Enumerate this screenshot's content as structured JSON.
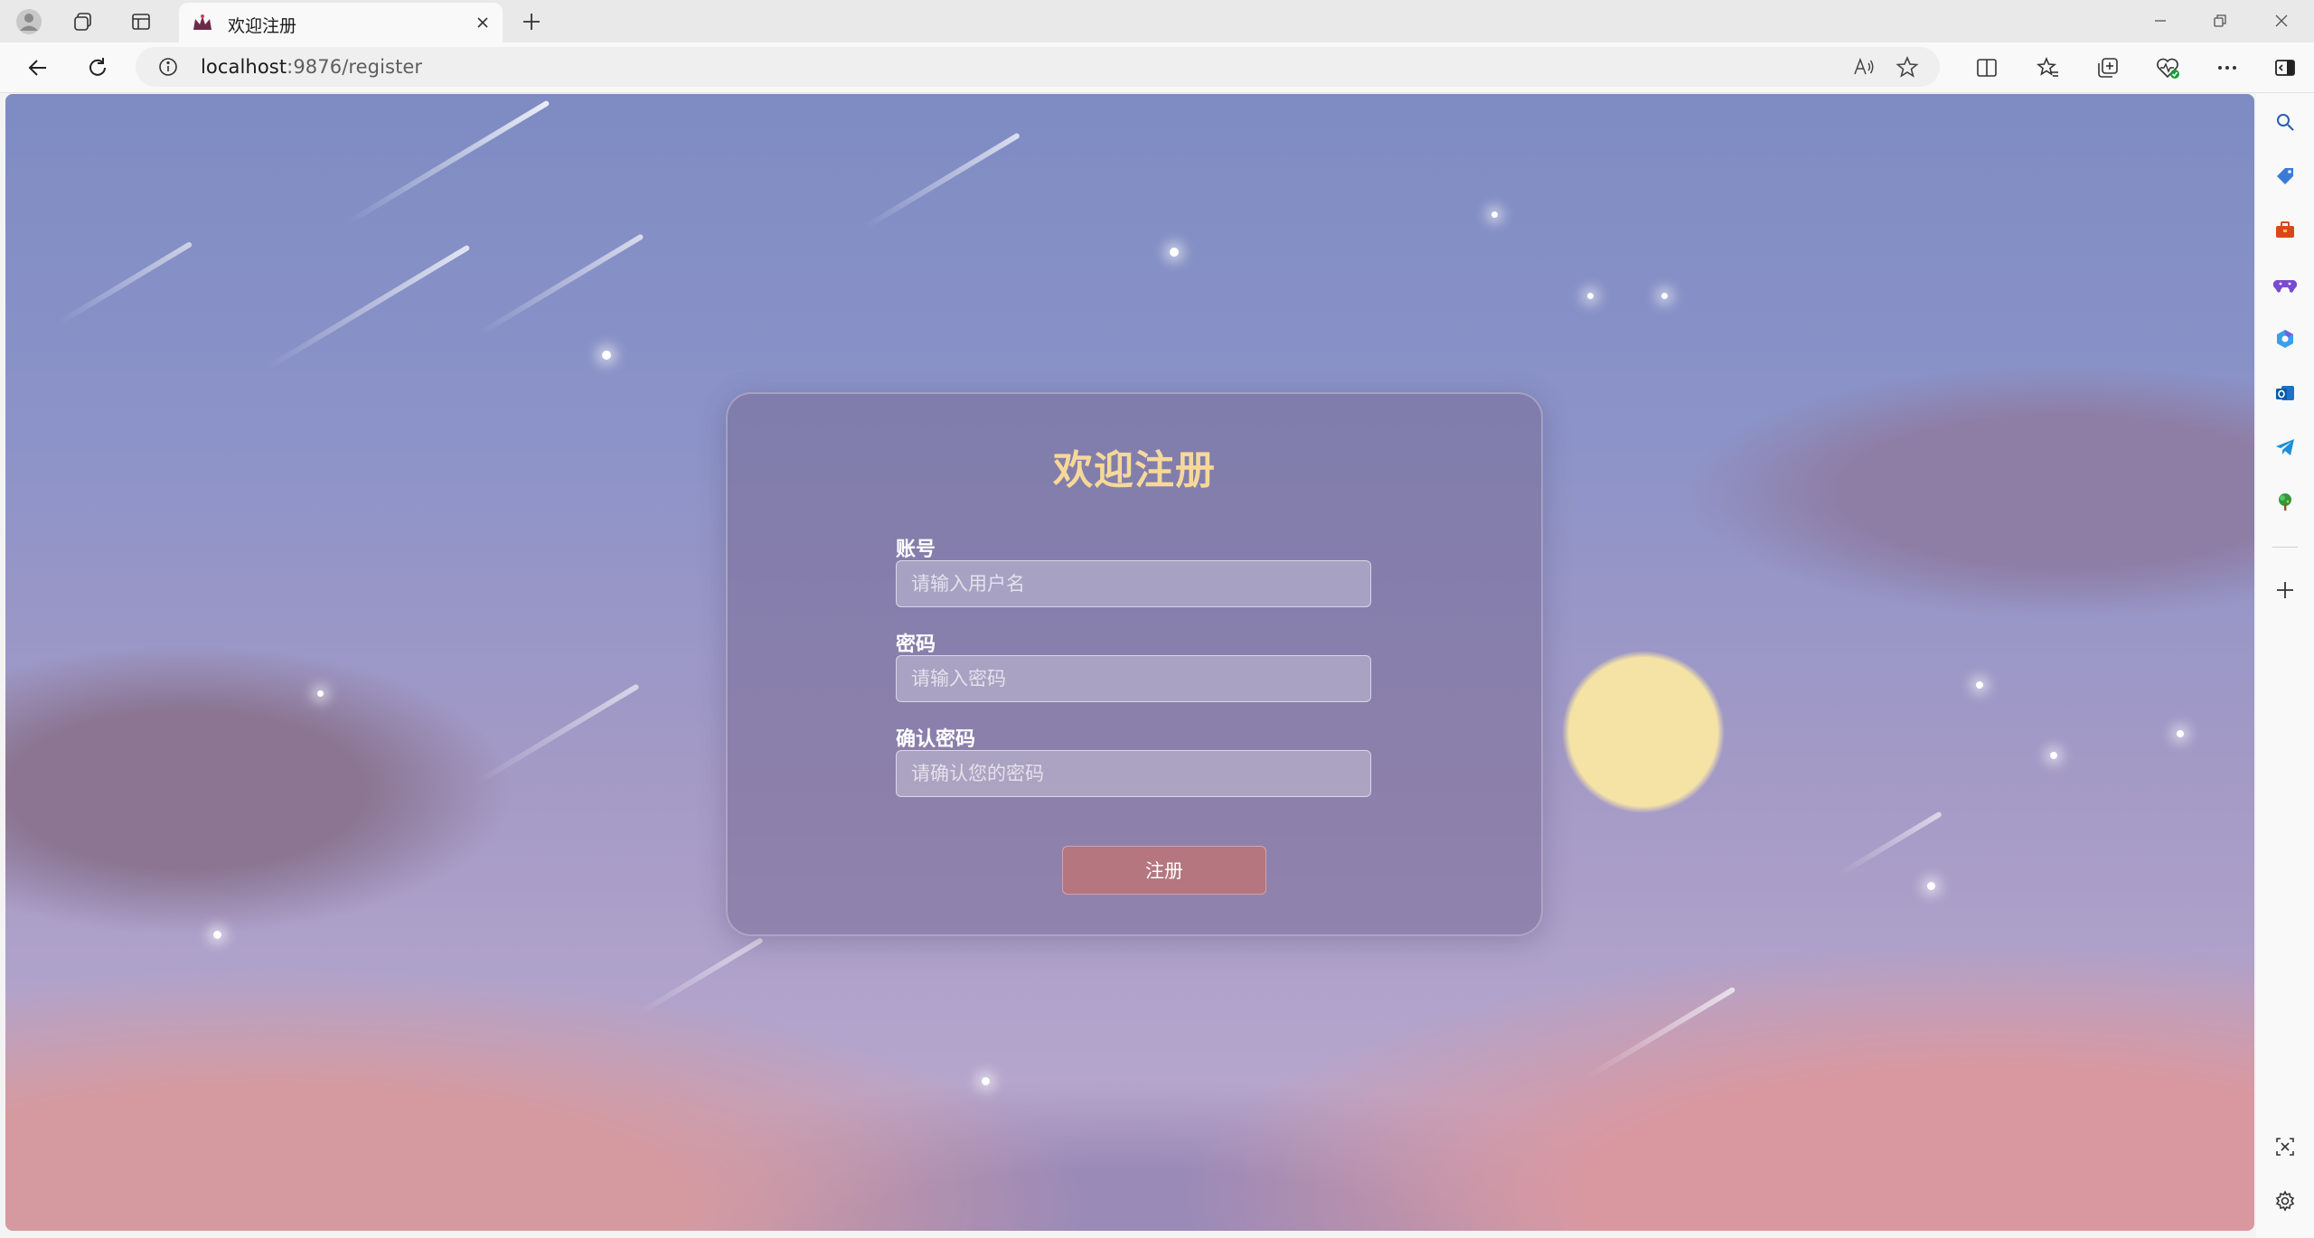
{
  "browser": {
    "tab": {
      "title": "欢迎注册",
      "favicon": "crown-favicon-icon"
    },
    "address_bar": {
      "host": "localhost",
      "path": ":9876/register"
    },
    "icons": {
      "profile": "profile-icon",
      "workspaces": "workspaces-icon",
      "tab_actions": "vertical-tabs-icon",
      "close_tab": "close-icon",
      "new_tab": "plus-icon",
      "minimize": "minimize-icon",
      "restore": "restore-icon",
      "close_window": "close-icon",
      "back": "back-arrow-icon",
      "refresh": "refresh-icon",
      "site_info": "info-icon",
      "read_aloud": "read-aloud-icon",
      "favorite": "star-icon",
      "split_screen": "split-screen-icon",
      "favorites": "favorites-icon",
      "collections": "collections-icon",
      "browser_essentials": "heart-pulse-icon",
      "more": "more-icon",
      "sidebar_toggle": "sidebar-toggle-icon"
    }
  },
  "sidebar": {
    "items": [
      {
        "name": "search-icon"
      },
      {
        "name": "shopping-tag-icon"
      },
      {
        "name": "tools-briefcase-icon"
      },
      {
        "name": "games-controller-icon"
      },
      {
        "name": "copilot-icon"
      },
      {
        "name": "outlook-icon"
      },
      {
        "name": "telegram-icon"
      },
      {
        "name": "tree-icon"
      },
      {
        "name": "add-icon"
      }
    ],
    "bottom": [
      {
        "name": "screenshot-icon"
      },
      {
        "name": "settings-gear-icon"
      }
    ]
  },
  "register": {
    "title": "欢迎注册",
    "username": {
      "label": "账号",
      "placeholder": "请输入用户名"
    },
    "password": {
      "label": "密码",
      "placeholder": "请输入密码"
    },
    "confirm_password": {
      "label": "确认密码",
      "placeholder": "请确认您的密码"
    },
    "submit_label": "注册"
  },
  "colors": {
    "title_accent": "#f6d89a",
    "button": "#b5767f",
    "sky_top": "#7e8cc3",
    "sky_bottom": "#c3a8c8"
  }
}
